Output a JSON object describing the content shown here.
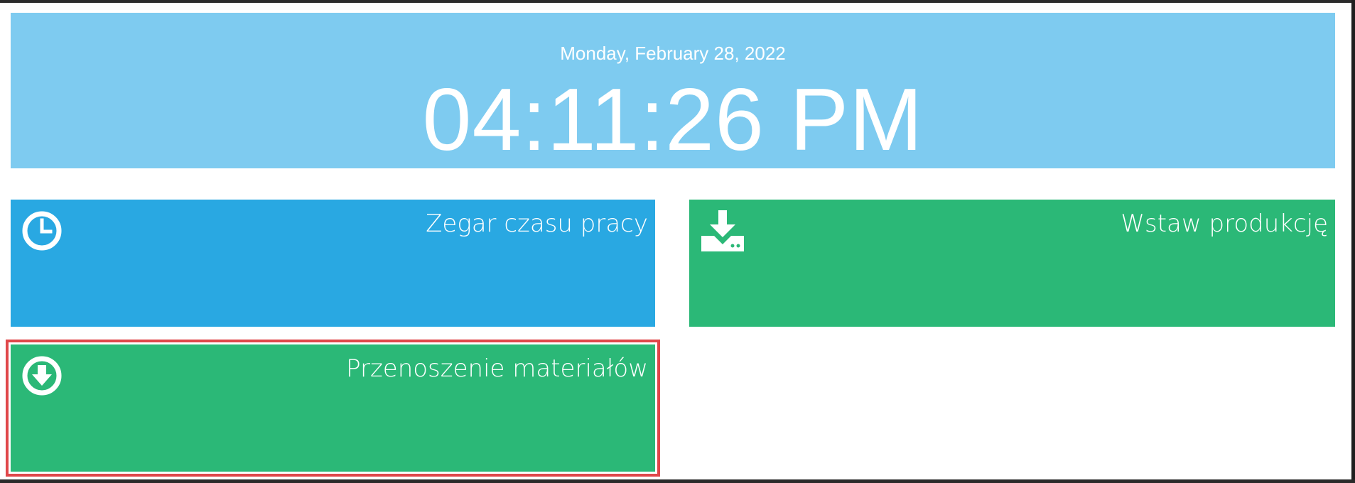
{
  "clock": {
    "date": "Monday, February 28, 2022",
    "time": "04:11:26 PM"
  },
  "tiles": [
    {
      "title": "Zegar czasu pracy",
      "icon": "clock-icon",
      "color": "#29a8e2"
    },
    {
      "title": "Wstaw produkcję",
      "icon": "download-tray-icon",
      "color": "#2bb877"
    },
    {
      "title": "Przenoszenie materiałów",
      "icon": "circle-arrow-down-icon",
      "color": "#2bb877"
    }
  ],
  "colors": {
    "clock_panel": "#7ecbf0",
    "highlight_border": "#e0474a"
  }
}
